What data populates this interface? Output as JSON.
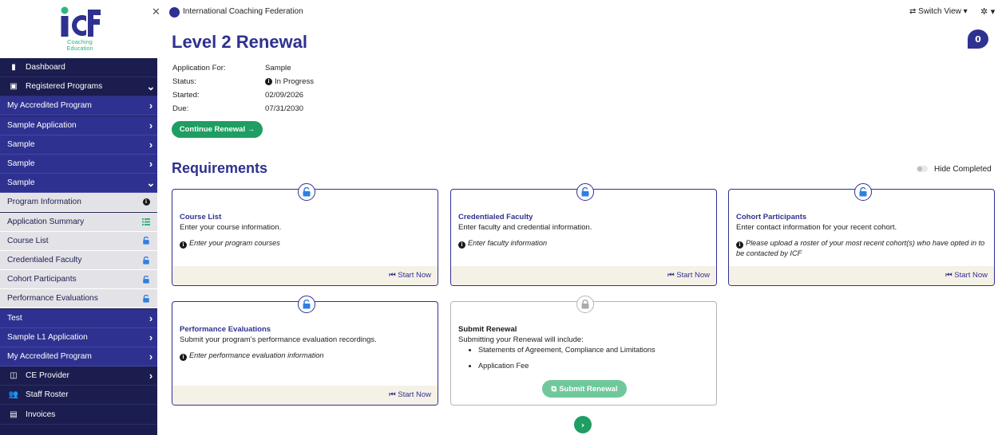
{
  "logo": {
    "subtitle_line1": "Coaching",
    "subtitle_line2": "Education",
    "brand_colors": [
      "#2f3190",
      "#2eb67d"
    ]
  },
  "topbar": {
    "org_name": "International Coaching Federation",
    "switch_view": "⇄ Switch View ▾",
    "settings": "✲ ▾",
    "close": "✕"
  },
  "sidebar": {
    "items": [
      {
        "label": "Dashboard",
        "icon": "building-icon",
        "icon_glyph": "▮",
        "style": "dark"
      },
      {
        "label": "Registered Programs",
        "icon": "id-card-icon",
        "icon_glyph": "▣",
        "chev": "⌄",
        "style": "dark"
      },
      {
        "label": "My Accredited Program",
        "chev": "›",
        "style": "blue"
      },
      {
        "label": "Sample Application",
        "chev": "›",
        "style": "blue"
      },
      {
        "label": "Sample",
        "chev": "›",
        "style": "blue"
      },
      {
        "label": "Sample",
        "chev": "›",
        "style": "blue"
      },
      {
        "label": "Sample",
        "chev": "⌄",
        "style": "blue"
      },
      {
        "label": "Program Information",
        "status": "info",
        "style": "light"
      },
      {
        "label": "Application Summary",
        "status": "list",
        "style": "light"
      },
      {
        "label": "Course List",
        "status": "lock",
        "style": "light"
      },
      {
        "label": "Credentialed Faculty",
        "status": "lock",
        "style": "light"
      },
      {
        "label": "Cohort Participants",
        "status": "lock",
        "style": "light"
      },
      {
        "label": "Performance Evaluations",
        "status": "lock",
        "style": "light"
      },
      {
        "label": "Test",
        "chev": "›",
        "style": "blue"
      },
      {
        "label": "Sample L1 Application",
        "chev": "›",
        "style": "blue"
      },
      {
        "label": "My Accredited Program",
        "chev": "›",
        "style": "blue"
      },
      {
        "label": "CE Provider",
        "icon": "ce-icon",
        "icon_glyph": "◫",
        "chev": "›",
        "style": "dark"
      },
      {
        "label": "Staff Roster",
        "icon": "people-icon",
        "icon_glyph": "👥",
        "style": "dark"
      },
      {
        "label": "Invoices",
        "icon": "document-icon",
        "icon_glyph": "▤",
        "style": "dark"
      }
    ]
  },
  "header": {
    "title": "Level 2 Renewal",
    "notification_count": "0",
    "application_for_label": "Application For:",
    "application_for_value": "Sample",
    "status_label": "Status:",
    "status_value": "In Progress",
    "started_label": "Started:",
    "started_value": "02/09/2026",
    "due_label": "Due:",
    "due_value": "07/31/2030",
    "continue_button": "Continue Renewal →"
  },
  "requirements": {
    "title": "Requirements",
    "hide_completed_label": "Hide Completed",
    "start_label": "Start Now",
    "cards": [
      {
        "title": "Course List",
        "desc": "Enter your course information.",
        "note": "Enter your program courses"
      },
      {
        "title": "Credentialed Faculty",
        "desc": "Enter faculty and credential information.",
        "note": "Enter faculty information"
      },
      {
        "title": "Cohort Participants",
        "desc": "Enter contact information for your recent cohort.",
        "note": "Please upload a roster of your most recent cohort(s) who have opted in to be contacted by ICF"
      },
      {
        "title": "Performance Evaluations",
        "desc": "Submit your program's performance evaluation recordings.",
        "note": "Enter performance evaluation information"
      }
    ],
    "submit_card": {
      "title": "Submit Renewal",
      "desc": "Submitting your Renewal will include:",
      "items": [
        "Statements of Agreement, Compliance and Limitations",
        "Application Fee"
      ],
      "button": "Submit Renewal"
    }
  }
}
